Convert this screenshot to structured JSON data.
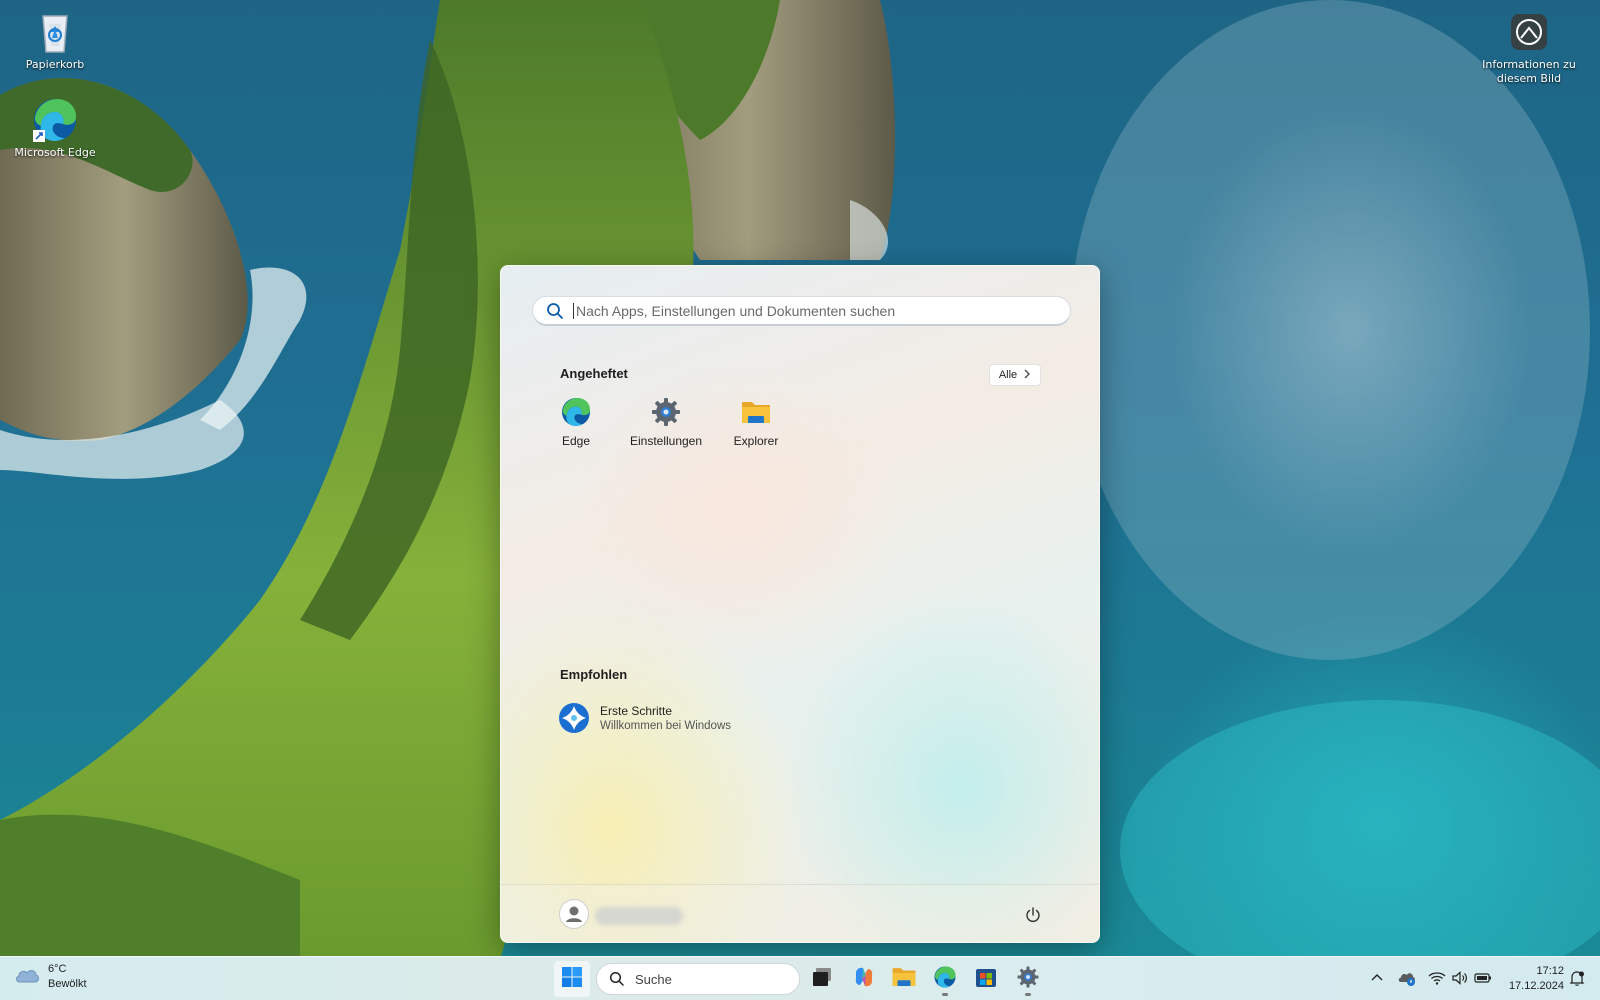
{
  "desktop": {
    "icons": [
      {
        "label": "Papierkorb",
        "icon": "recycle-bin-icon"
      },
      {
        "label": "Microsoft Edge",
        "icon": "edge-icon"
      },
      {
        "label": "Informationen zu diesem Bild",
        "icon": "camera-info-icon"
      }
    ]
  },
  "start_menu": {
    "search_placeholder": "Nach Apps, Einstellungen und Dokumenten suchen",
    "pinned_title": "Angeheftet",
    "all_label": "Alle",
    "pinned_apps": [
      {
        "label": "Edge",
        "icon": "edge-icon"
      },
      {
        "label": "Einstellungen",
        "icon": "settings-gear-icon"
      },
      {
        "label": "Explorer",
        "icon": "folder-icon"
      }
    ],
    "recommended_title": "Empfohlen",
    "recommended": [
      {
        "title": "Erste Schritte",
        "subtitle": "Willkommen bei Windows",
        "icon": "get-started-icon"
      }
    ],
    "user_icon": "user-avatar-icon",
    "power_icon": "power-icon"
  },
  "taskbar": {
    "weather": {
      "temp": "6°C",
      "condition": "Bewölkt",
      "icon": "cloud-icon"
    },
    "search_label": "Suche",
    "apps": [
      {
        "name": "task-view",
        "icon": "task-view-icon"
      },
      {
        "name": "copilot",
        "icon": "copilot-icon"
      },
      {
        "name": "explorer",
        "icon": "folder-icon"
      },
      {
        "name": "edge",
        "icon": "edge-icon",
        "running": true
      },
      {
        "name": "store",
        "icon": "store-icon"
      },
      {
        "name": "settings",
        "icon": "settings-gear-icon",
        "running": true
      }
    ],
    "tray": [
      "chevron-up-icon",
      "onedrive-icon",
      "wifi-icon",
      "volume-icon",
      "battery-icon"
    ],
    "time": "17:12",
    "date": "17.12.2024",
    "notification_icon": "notification-bell-icon"
  },
  "colors": {
    "accent": "#0078d4",
    "edge_blue": "#0c59a4",
    "edge_green": "#4fc45c",
    "folder_yellow": "#f7c33d"
  }
}
